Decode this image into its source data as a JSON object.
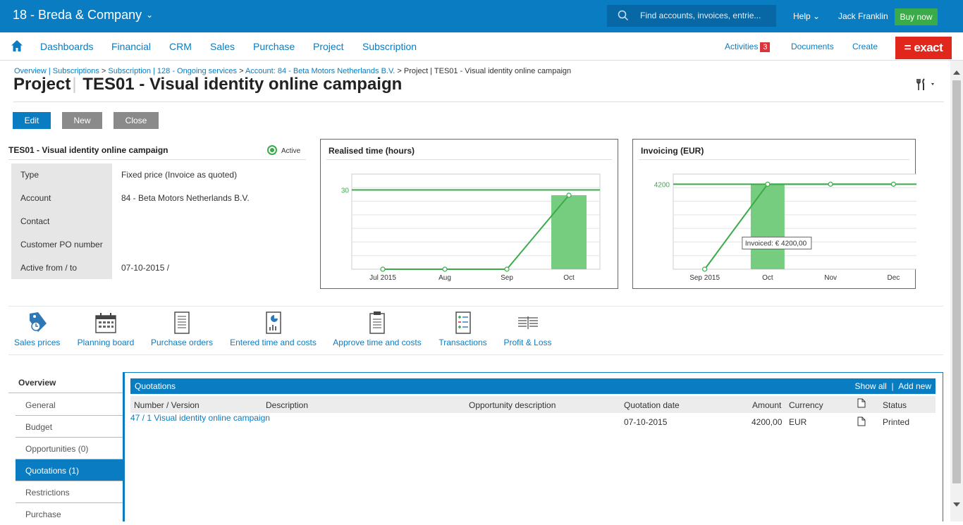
{
  "topbar": {
    "company": "18 - Breda & Company",
    "search_placeholder": "Find accounts, invoices, entrie...",
    "help": "Help",
    "user": "Jack Franklin",
    "buy_now": "Buy now"
  },
  "menu": {
    "items": [
      "Dashboards",
      "Financial",
      "CRM",
      "Sales",
      "Purchase",
      "Project",
      "Subscription"
    ],
    "activities": "Activities",
    "activities_count": "3",
    "documents": "Documents",
    "create": "Create",
    "logo": "= exact"
  },
  "breadcrumb": {
    "links": [
      "Overview | Subscriptions",
      "Subscription | 128 - Ongoing services",
      "Account: 84 - Beta Motors Netherlands B.V."
    ],
    "current": "Project | TES01 - Visual identity online campaign"
  },
  "page": {
    "title_prefix": "Project",
    "title": "TES01 - Visual identity online campaign"
  },
  "buttons": {
    "edit": "Edit",
    "new": "New",
    "close": "Close"
  },
  "details": {
    "title": "TES01 - Visual identity online campaign",
    "status": "Active",
    "rows": [
      {
        "label": "Type",
        "value": "Fixed price (Invoice as quoted)"
      },
      {
        "label": "Account",
        "value": "84 - Beta Motors Netherlands B.V."
      },
      {
        "label": "Contact",
        "value": ""
      },
      {
        "label": "Customer PO number",
        "value": ""
      },
      {
        "label": "Active from / to",
        "value": "07-10-2015 /"
      }
    ]
  },
  "chart_data": [
    {
      "type": "bar",
      "title": "Realised time (hours)",
      "categories": [
        "Jul 2015",
        "Aug",
        "Sep",
        "Oct"
      ],
      "values": [
        0,
        0,
        0,
        28
      ],
      "line_values": [
        0,
        0,
        0,
        28
      ],
      "reference_line": 30,
      "ytick_label": "30",
      "ylim": [
        0,
        36
      ]
    },
    {
      "type": "bar",
      "title": "Invoicing (EUR)",
      "categories": [
        "Sep 2015",
        "Oct",
        "Nov",
        "Dec"
      ],
      "values": [
        0,
        4200,
        0,
        0
      ],
      "line_values": [
        0,
        4200,
        4200,
        4200
      ],
      "reference_line": 4200,
      "ytick_label": "4200",
      "ylim": [
        0,
        4700
      ],
      "tooltip": "Invoiced: € 4200,00"
    }
  ],
  "shortcuts": [
    "Sales prices",
    "Planning board",
    "Purchase orders",
    "Entered time and costs",
    "Approve time and costs",
    "Transactions",
    "Profit & Loss"
  ],
  "sidenav": {
    "head": "Overview",
    "items": [
      "General",
      "Budget",
      "Opportunities (0)",
      "Quotations (1)",
      "Restrictions",
      "Purchase"
    ]
  },
  "quotations": {
    "title": "Quotations",
    "show_all": "Show all",
    "add_new": "Add new",
    "columns": [
      "Number / Version",
      "Description",
      "Opportunity description",
      "Quotation date",
      "Amount",
      "Currency",
      "Status"
    ],
    "rows": [
      {
        "number": "47 / 1",
        "description": "Visual identity online campaign",
        "opportunity": "",
        "date": "07-10-2015",
        "amount": "4200,00",
        "currency": "EUR",
        "status": "Printed"
      }
    ]
  },
  "colors": {
    "brand_blue": "#0a7cc1",
    "chart_green": "#3bab49",
    "bar_green": "#76cd7f",
    "exact_red": "#e1261c"
  }
}
